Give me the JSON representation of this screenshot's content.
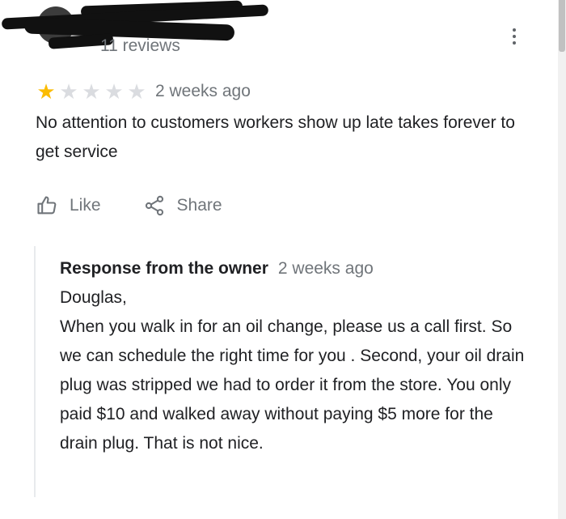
{
  "reviewer": {
    "review_count": "11 reviews"
  },
  "review": {
    "rating": 1,
    "max_rating": 5,
    "time": "2 weeks ago",
    "text": "No attention to customers workers show up late takes forever to get service"
  },
  "actions": {
    "like_label": "Like",
    "share_label": "Share"
  },
  "owner_response": {
    "title": "Response from the owner",
    "time": "2 weeks ago",
    "lines": [
      "Douglas,",
      "When you walk in for an oil change, please us a call first. So we can schedule the right time for you . Second, your oil drain plug was stripped we had to order it from the store. You only paid $10 and walked away without paying $5 more for the drain plug. That is not nice."
    ]
  },
  "colors": {
    "star_filled": "#fbbc04",
    "star_empty": "#dadce0",
    "secondary_text": "#70757a",
    "primary_text": "#202124"
  },
  "icons": {
    "like": "thumbs-up-icon",
    "share": "share-icon",
    "more": "more-vert-icon"
  }
}
